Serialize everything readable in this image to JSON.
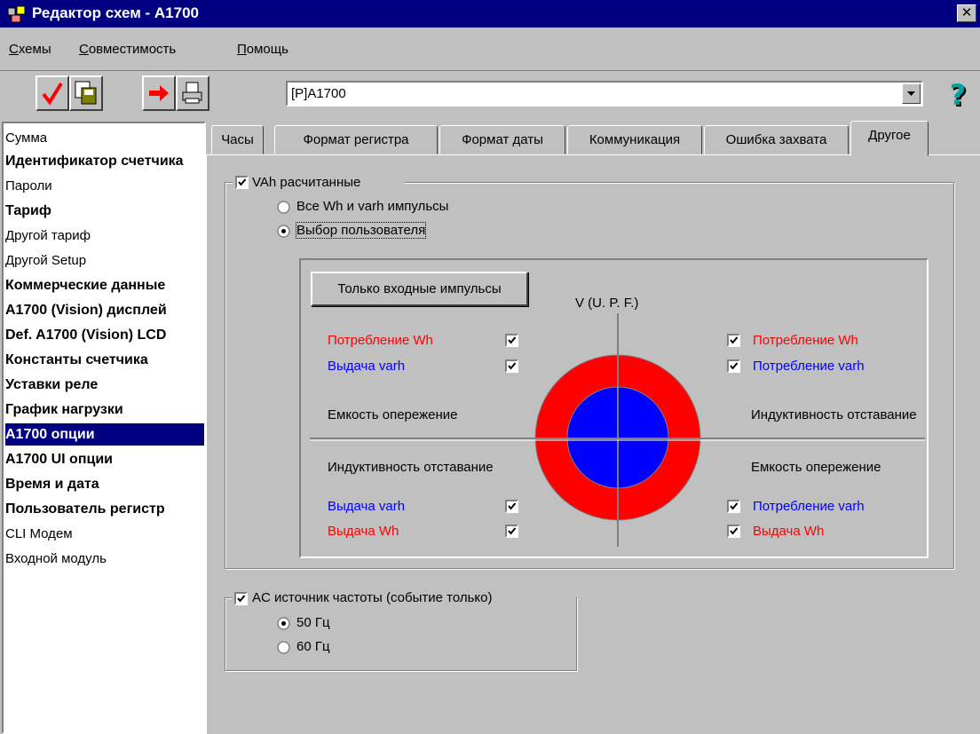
{
  "window": {
    "title": "Редактор схем - A1700",
    "close": "✕"
  },
  "menu": {
    "items": [
      {
        "ul": "С",
        "rest": "хемы"
      },
      {
        "ul": "С",
        "rest": "овместимость"
      },
      {
        "ul": "П",
        "rest": "омощь"
      }
    ]
  },
  "toolbar": {
    "schema_value": "[P]A1700",
    "help": "?"
  },
  "sidebar": {
    "items": [
      "Сумма",
      "Идентификатор счетчика",
      "Пароли",
      "Тариф",
      "Другой тариф",
      "Другой Setup",
      "Коммерческие данные",
      "A1700 (Vision) дисплей",
      "Def. A1700 (Vision) LCD",
      "Константы счетчика",
      "Уставки реле",
      "График нагрузки",
      "A1700 опции",
      "A1700 UI опции",
      "Время и дата",
      "Пользователь регистр",
      "CLI Модем",
      "Входной модуль"
    ]
  },
  "tabs": [
    "Часы",
    "Формат регистра",
    "Формат даты",
    "Коммуникация",
    "Ошибка захвата",
    "Другое"
  ],
  "vah": {
    "group_label": "VAh  расчитанные",
    "checked": true,
    "radio_all": "Все Wh и varh импульсы",
    "radio_user": "Выбор пользователя",
    "selected": "user",
    "input_only_button": "Только входные импульсы",
    "vupf_label": "V (U. P. F.)",
    "left_top": [
      {
        "label": "Потребление Wh",
        "color": "#ff0000",
        "checked": true
      },
      {
        "label": "Выдача varh",
        "color": "#0000ff",
        "checked": true
      }
    ],
    "right_top": [
      {
        "label": "Потребление Wh",
        "color": "#ff0000",
        "checked": true
      },
      {
        "label": "Потребление varh",
        "color": "#0000ff",
        "checked": true
      }
    ],
    "quad_left_top": "Емкость опережение",
    "quad_right_top": "Индуктивность отставание",
    "quad_left_bottom": "Индуктивность отставание",
    "quad_right_bottom": "Емкость опережение",
    "left_bottom": [
      {
        "label": "Выдача varh",
        "color": "#0000ff",
        "checked": true
      },
      {
        "label": "Выдача Wh",
        "color": "#ff0000",
        "checked": true
      }
    ],
    "right_bottom": [
      {
        "label": "Потребление varh",
        "color": "#0000ff",
        "checked": true
      },
      {
        "label": "Выдача Wh",
        "color": "#ff0000",
        "checked": true
      }
    ]
  },
  "ac": {
    "group_label": "AC источник частоты (событие только)",
    "checked": true,
    "radio_50": "50 Гц",
    "radio_60": "60 Гц",
    "selected": "50"
  }
}
